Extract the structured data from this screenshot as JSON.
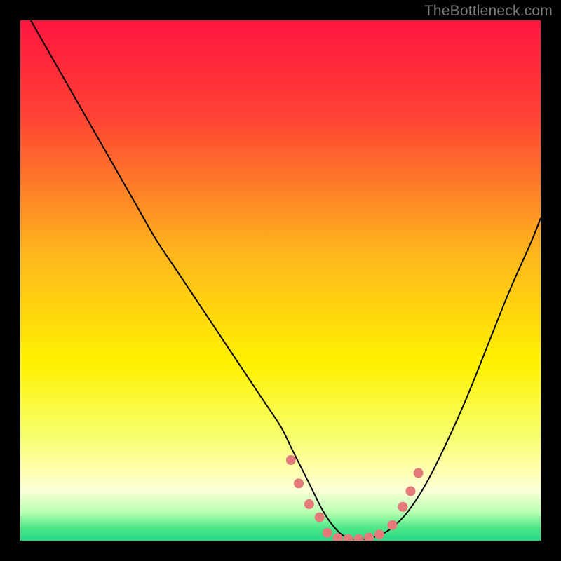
{
  "watermark": "TheBottleneck.com",
  "chart_data": {
    "type": "line",
    "title": "",
    "xlabel": "",
    "ylabel": "",
    "xlim": [
      0,
      100
    ],
    "ylim": [
      0,
      100
    ],
    "grid": false,
    "legend": false,
    "background_gradient": {
      "stops": [
        {
          "pos": 0.0,
          "color": "#ff163f"
        },
        {
          "pos": 0.18,
          "color": "#ff4034"
        },
        {
          "pos": 0.45,
          "color": "#ffb71c"
        },
        {
          "pos": 0.66,
          "color": "#fff200"
        },
        {
          "pos": 0.8,
          "color": "#f6ff6e"
        },
        {
          "pos": 0.86,
          "color": "#ffffaa"
        },
        {
          "pos": 0.905,
          "color": "#faffd6"
        },
        {
          "pos": 0.945,
          "color": "#b8ffb0"
        },
        {
          "pos": 0.975,
          "color": "#4fe889"
        },
        {
          "pos": 1.0,
          "color": "#25d987"
        }
      ]
    },
    "series": [
      {
        "name": "bottleneck-curve",
        "color": "#000000",
        "width": 2,
        "x": [
          2,
          6,
          10,
          14,
          18,
          22,
          26,
          30,
          34,
          38,
          42,
          46,
          50,
          52,
          54,
          56,
          58,
          60,
          62,
          64,
          66,
          70,
          74,
          78,
          82,
          86,
          90,
          94,
          98,
          100
        ],
        "y": [
          100,
          93,
          86,
          79,
          72,
          65,
          58,
          52,
          46,
          40,
          34,
          28,
          22,
          18,
          14,
          10,
          6,
          3,
          1,
          0.3,
          0.3,
          1.5,
          5,
          11,
          19,
          28,
          38,
          48,
          57,
          62
        ]
      }
    ],
    "markers": {
      "name": "salmon-dots",
      "color": "#e47a7a",
      "radius": 7,
      "points": [
        {
          "x": 52.0,
          "y": 15.5
        },
        {
          "x": 53.5,
          "y": 11.0
        },
        {
          "x": 55.5,
          "y": 7.0
        },
        {
          "x": 57.5,
          "y": 4.5
        },
        {
          "x": 59.0,
          "y": 1.5
        },
        {
          "x": 61.0,
          "y": 0.5
        },
        {
          "x": 63.0,
          "y": 0.3
        },
        {
          "x": 65.0,
          "y": 0.3
        },
        {
          "x": 67.0,
          "y": 0.6
        },
        {
          "x": 69.0,
          "y": 1.2
        },
        {
          "x": 71.5,
          "y": 3.0
        },
        {
          "x": 73.5,
          "y": 6.5
        },
        {
          "x": 75.0,
          "y": 9.5
        },
        {
          "x": 76.5,
          "y": 13.0
        }
      ]
    }
  }
}
